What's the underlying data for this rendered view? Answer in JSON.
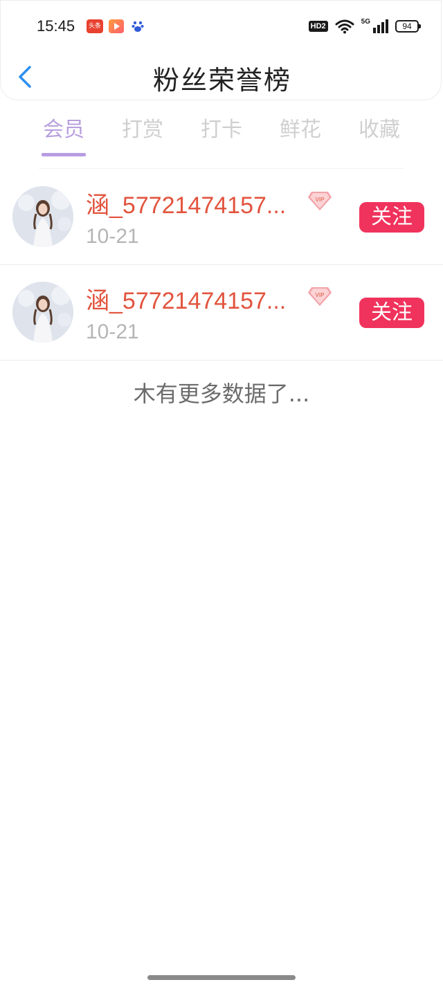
{
  "status_bar": {
    "time": "15:45",
    "apps": [
      "toutiao-app-icon",
      "video-app-icon",
      "baidu-app-icon"
    ],
    "toutiao_label": "头条",
    "hd_label": "HD2",
    "network_label": "5G",
    "battery": "94"
  },
  "nav": {
    "title": "粉丝荣誉榜",
    "back_icon": "chevron-left-icon"
  },
  "tabs": [
    {
      "label": "会员",
      "active": true
    },
    {
      "label": "打赏",
      "active": false
    },
    {
      "label": "打卡",
      "active": false
    },
    {
      "label": "鲜花",
      "active": false
    },
    {
      "label": "收藏",
      "active": false
    }
  ],
  "list": [
    {
      "name": "涵_57721474157...",
      "date": "10-21",
      "badge": "VIP",
      "follow_label": "关注"
    },
    {
      "name": "涵_57721474157...",
      "date": "10-21",
      "badge": "VIP",
      "follow_label": "关注"
    }
  ],
  "footer_text": "木有更多数据了...",
  "colors": {
    "accent_purple": "#b79ce2",
    "name_red": "#e2533d",
    "follow_pink": "#f0335c",
    "back_blue": "#2b8ff0"
  }
}
